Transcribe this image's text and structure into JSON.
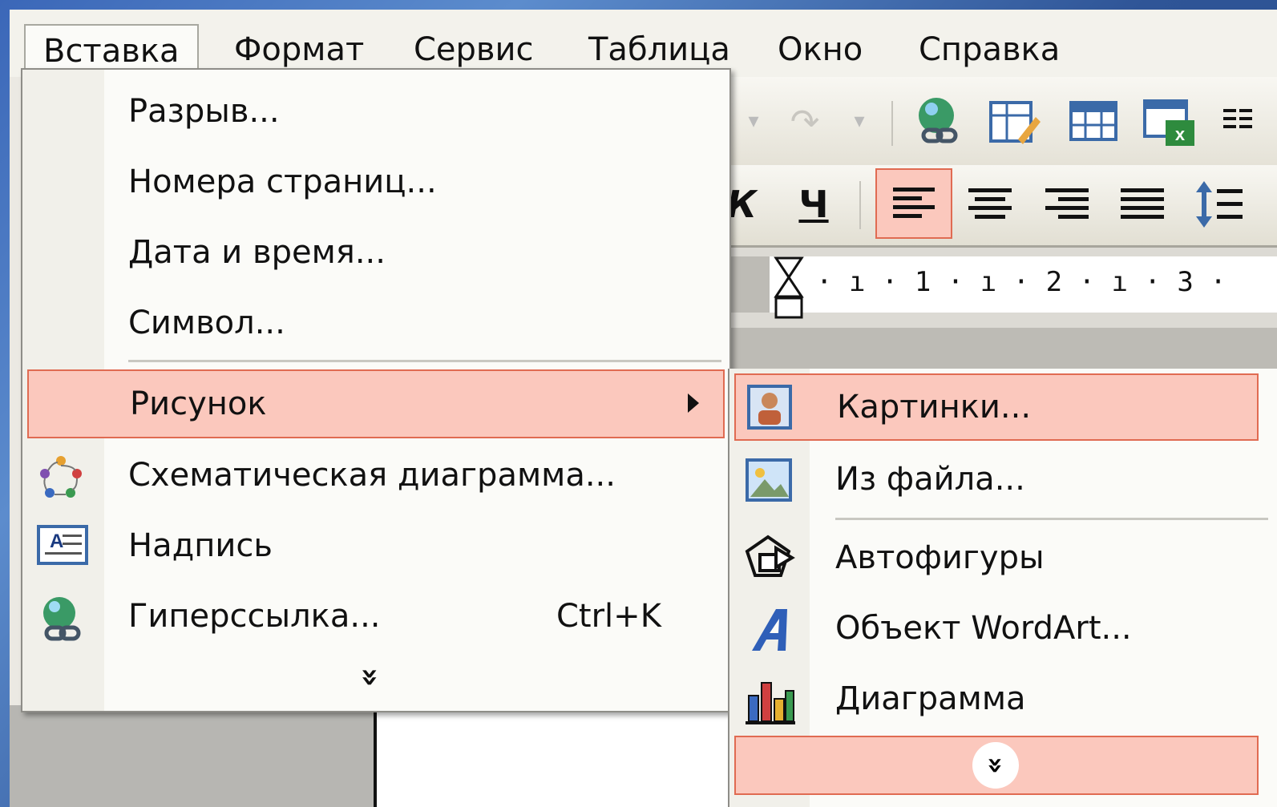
{
  "menubar": {
    "items": [
      "Вставка",
      "Формат",
      "Сервис",
      "Таблица",
      "Окно",
      "Справка"
    ]
  },
  "insert_menu": {
    "items": [
      {
        "label": "Разрыв..."
      },
      {
        "label": "Номера страниц..."
      },
      {
        "label": "Дата и время..."
      },
      {
        "label": "Символ..."
      },
      {
        "label": "Рисунок",
        "submenu": true,
        "highlighted": true
      },
      {
        "label": "Схематическая диаграмма...",
        "icon": "diagram-icon"
      },
      {
        "label": "Надпись",
        "icon": "textbox-icon"
      },
      {
        "label": "Гиперссылка...",
        "shortcut": "Ctrl+K",
        "icon": "hyperlink-icon"
      }
    ],
    "expand_glyph": "»"
  },
  "picture_submenu": {
    "items": [
      {
        "label": "Картинки...",
        "icon": "clipart-icon",
        "highlighted": true
      },
      {
        "label": "Из файла...",
        "icon": "picture-file-icon"
      },
      {
        "label": "Автофигуры",
        "icon": "autoshapes-icon"
      },
      {
        "label": "Объект WordArt...",
        "icon": "wordart-icon"
      },
      {
        "label": "Диаграмма",
        "icon": "chart-icon"
      }
    ],
    "expand_glyph": "»"
  },
  "toolbar": {
    "underline_label": "Ч",
    "italic_label": "К"
  },
  "ruler": {
    "ticks": [
      "1",
      "2",
      "3"
    ]
  },
  "colors": {
    "highlight_fill": "#fbc8bd",
    "highlight_border": "#e06b52",
    "menu_bg": "#fbfbf8"
  }
}
